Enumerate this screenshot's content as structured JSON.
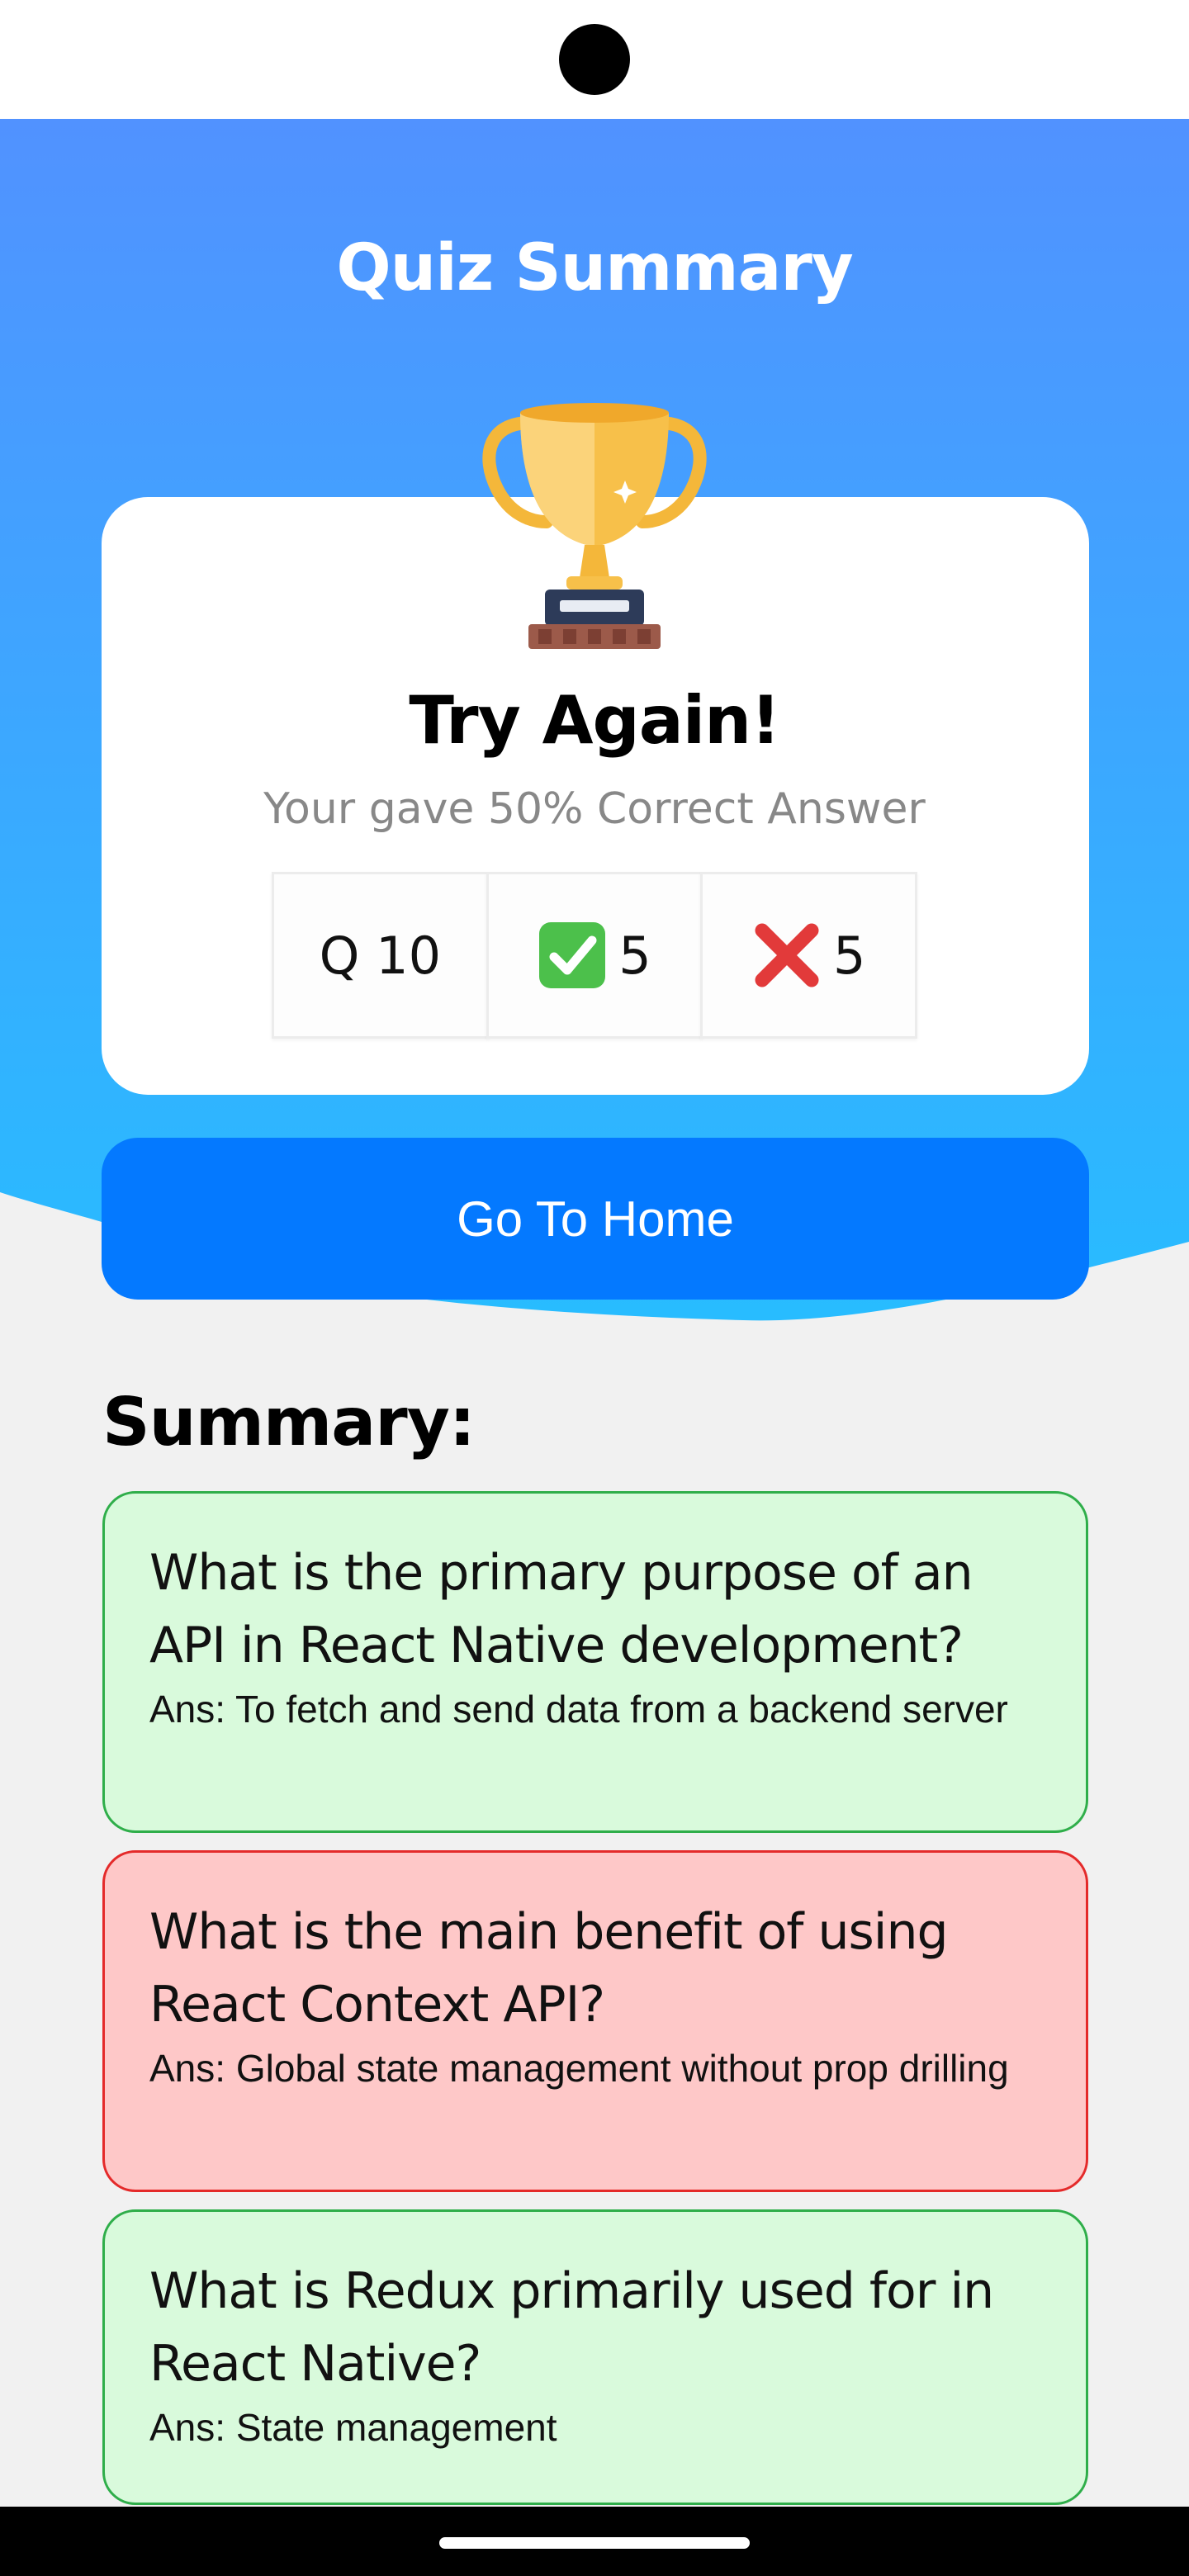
{
  "page": {
    "title": "Quiz Summary"
  },
  "result": {
    "heading": "Try Again!",
    "subtitle": "Your gave 50% Correct Answer",
    "trophy_icon": "trophy-icon",
    "stats": [
      {
        "name": "total",
        "icon": "",
        "value": "Q 10"
      },
      {
        "name": "correct",
        "icon": "check-mark-icon",
        "value": "5"
      },
      {
        "name": "wrong",
        "icon": "cross-mark-icon",
        "value": "5"
      }
    ]
  },
  "home_button": {
    "label": "Go To Home"
  },
  "summary": {
    "heading": "Summary:",
    "items": [
      {
        "question": "What is the primary purpose of an API in React Native development?",
        "answer": "Ans: To fetch and send data from a backend server",
        "status": "correct"
      },
      {
        "question": "What is the main benefit of using React Context API?",
        "answer": "Ans: Global state management without prop drilling",
        "status": "wrong"
      },
      {
        "question": "What is Redux primarily used for in React Native?",
        "answer": "Ans: State management",
        "status": "correct"
      }
    ]
  },
  "colors": {
    "header_top": "#5192ff",
    "header_bottom": "#28bcff",
    "button": "#0479ff",
    "correct_bg": "#d9fadc",
    "correct_border": "#2fae4a",
    "wrong_bg": "#fec8c8",
    "wrong_border": "#e42a2a"
  }
}
